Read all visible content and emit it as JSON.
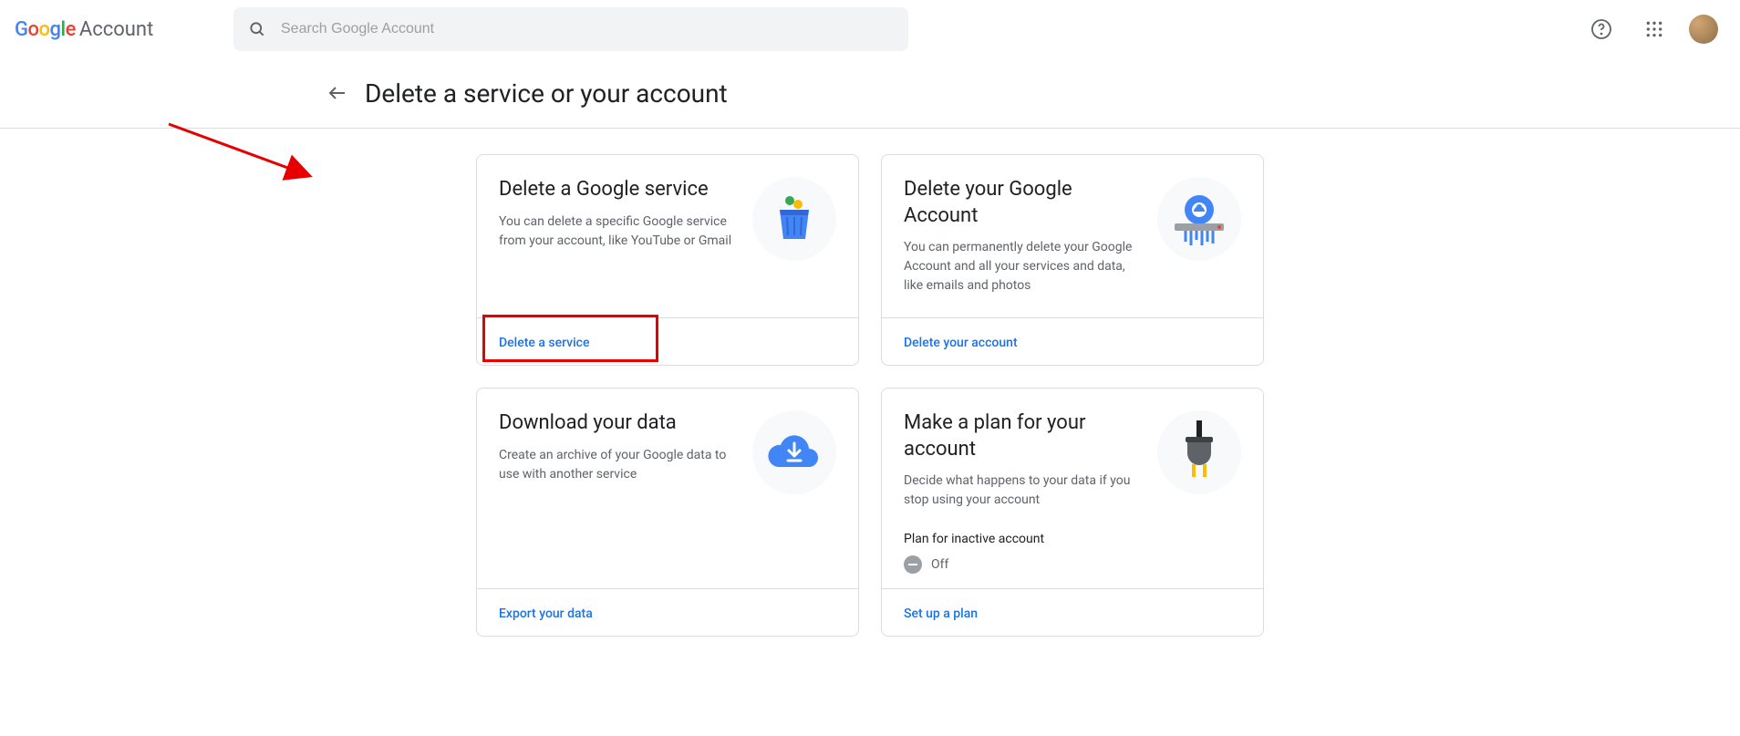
{
  "header": {
    "logo_account_label": "Account",
    "search_placeholder": "Search Google Account"
  },
  "page": {
    "title": "Delete a service or your account"
  },
  "cards": [
    {
      "title": "Delete a Google service",
      "desc": "You can delete a specific Google service from your account, like YouTube or Gmail",
      "link": "Delete a service"
    },
    {
      "title": "Delete your Google Account",
      "desc": "You can permanently delete your Google Account and all your services and data, like emails and photos",
      "link": "Delete your account"
    },
    {
      "title": "Download your data",
      "desc": "Create an archive of your Google data to use with another service",
      "link": "Export your data"
    },
    {
      "title": "Make a plan for your account",
      "desc": "Decide what happens to your data if you stop using your account",
      "extra_label": "Plan for inactive account",
      "extra_value": "Off",
      "link": "Set up a plan"
    }
  ]
}
